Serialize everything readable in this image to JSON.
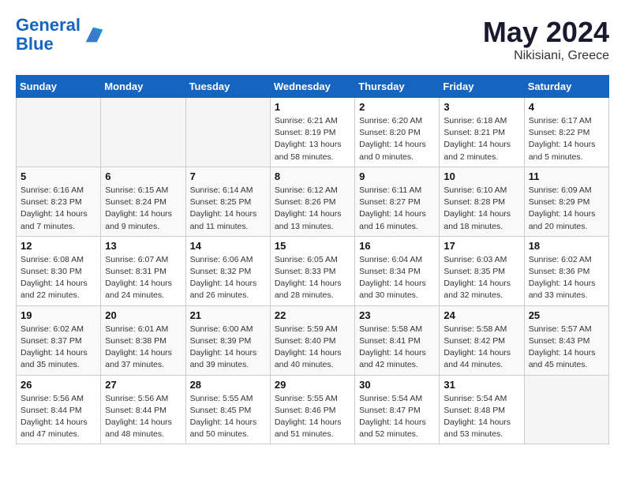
{
  "header": {
    "logo_line1": "General",
    "logo_line2": "Blue",
    "main_title": "May 2024",
    "subtitle": "Nikisiani, Greece"
  },
  "calendar": {
    "days_of_week": [
      "Sunday",
      "Monday",
      "Tuesday",
      "Wednesday",
      "Thursday",
      "Friday",
      "Saturday"
    ],
    "weeks": [
      [
        {
          "day": "",
          "info": ""
        },
        {
          "day": "",
          "info": ""
        },
        {
          "day": "",
          "info": ""
        },
        {
          "day": "1",
          "info": "Sunrise: 6:21 AM\nSunset: 8:19 PM\nDaylight: 13 hours\nand 58 minutes."
        },
        {
          "day": "2",
          "info": "Sunrise: 6:20 AM\nSunset: 8:20 PM\nDaylight: 14 hours\nand 0 minutes."
        },
        {
          "day": "3",
          "info": "Sunrise: 6:18 AM\nSunset: 8:21 PM\nDaylight: 14 hours\nand 2 minutes."
        },
        {
          "day": "4",
          "info": "Sunrise: 6:17 AM\nSunset: 8:22 PM\nDaylight: 14 hours\nand 5 minutes."
        }
      ],
      [
        {
          "day": "5",
          "info": "Sunrise: 6:16 AM\nSunset: 8:23 PM\nDaylight: 14 hours\nand 7 minutes."
        },
        {
          "day": "6",
          "info": "Sunrise: 6:15 AM\nSunset: 8:24 PM\nDaylight: 14 hours\nand 9 minutes."
        },
        {
          "day": "7",
          "info": "Sunrise: 6:14 AM\nSunset: 8:25 PM\nDaylight: 14 hours\nand 11 minutes."
        },
        {
          "day": "8",
          "info": "Sunrise: 6:12 AM\nSunset: 8:26 PM\nDaylight: 14 hours\nand 13 minutes."
        },
        {
          "day": "9",
          "info": "Sunrise: 6:11 AM\nSunset: 8:27 PM\nDaylight: 14 hours\nand 16 minutes."
        },
        {
          "day": "10",
          "info": "Sunrise: 6:10 AM\nSunset: 8:28 PM\nDaylight: 14 hours\nand 18 minutes."
        },
        {
          "day": "11",
          "info": "Sunrise: 6:09 AM\nSunset: 8:29 PM\nDaylight: 14 hours\nand 20 minutes."
        }
      ],
      [
        {
          "day": "12",
          "info": "Sunrise: 6:08 AM\nSunset: 8:30 PM\nDaylight: 14 hours\nand 22 minutes."
        },
        {
          "day": "13",
          "info": "Sunrise: 6:07 AM\nSunset: 8:31 PM\nDaylight: 14 hours\nand 24 minutes."
        },
        {
          "day": "14",
          "info": "Sunrise: 6:06 AM\nSunset: 8:32 PM\nDaylight: 14 hours\nand 26 minutes."
        },
        {
          "day": "15",
          "info": "Sunrise: 6:05 AM\nSunset: 8:33 PM\nDaylight: 14 hours\nand 28 minutes."
        },
        {
          "day": "16",
          "info": "Sunrise: 6:04 AM\nSunset: 8:34 PM\nDaylight: 14 hours\nand 30 minutes."
        },
        {
          "day": "17",
          "info": "Sunrise: 6:03 AM\nSunset: 8:35 PM\nDaylight: 14 hours\nand 32 minutes."
        },
        {
          "day": "18",
          "info": "Sunrise: 6:02 AM\nSunset: 8:36 PM\nDaylight: 14 hours\nand 33 minutes."
        }
      ],
      [
        {
          "day": "19",
          "info": "Sunrise: 6:02 AM\nSunset: 8:37 PM\nDaylight: 14 hours\nand 35 minutes."
        },
        {
          "day": "20",
          "info": "Sunrise: 6:01 AM\nSunset: 8:38 PM\nDaylight: 14 hours\nand 37 minutes."
        },
        {
          "day": "21",
          "info": "Sunrise: 6:00 AM\nSunset: 8:39 PM\nDaylight: 14 hours\nand 39 minutes."
        },
        {
          "day": "22",
          "info": "Sunrise: 5:59 AM\nSunset: 8:40 PM\nDaylight: 14 hours\nand 40 minutes."
        },
        {
          "day": "23",
          "info": "Sunrise: 5:58 AM\nSunset: 8:41 PM\nDaylight: 14 hours\nand 42 minutes."
        },
        {
          "day": "24",
          "info": "Sunrise: 5:58 AM\nSunset: 8:42 PM\nDaylight: 14 hours\nand 44 minutes."
        },
        {
          "day": "25",
          "info": "Sunrise: 5:57 AM\nSunset: 8:43 PM\nDaylight: 14 hours\nand 45 minutes."
        }
      ],
      [
        {
          "day": "26",
          "info": "Sunrise: 5:56 AM\nSunset: 8:44 PM\nDaylight: 14 hours\nand 47 minutes."
        },
        {
          "day": "27",
          "info": "Sunrise: 5:56 AM\nSunset: 8:44 PM\nDaylight: 14 hours\nand 48 minutes."
        },
        {
          "day": "28",
          "info": "Sunrise: 5:55 AM\nSunset: 8:45 PM\nDaylight: 14 hours\nand 50 minutes."
        },
        {
          "day": "29",
          "info": "Sunrise: 5:55 AM\nSunset: 8:46 PM\nDaylight: 14 hours\nand 51 minutes."
        },
        {
          "day": "30",
          "info": "Sunrise: 5:54 AM\nSunset: 8:47 PM\nDaylight: 14 hours\nand 52 minutes."
        },
        {
          "day": "31",
          "info": "Sunrise: 5:54 AM\nSunset: 8:48 PM\nDaylight: 14 hours\nand 53 minutes."
        },
        {
          "day": "",
          "info": ""
        }
      ]
    ]
  }
}
